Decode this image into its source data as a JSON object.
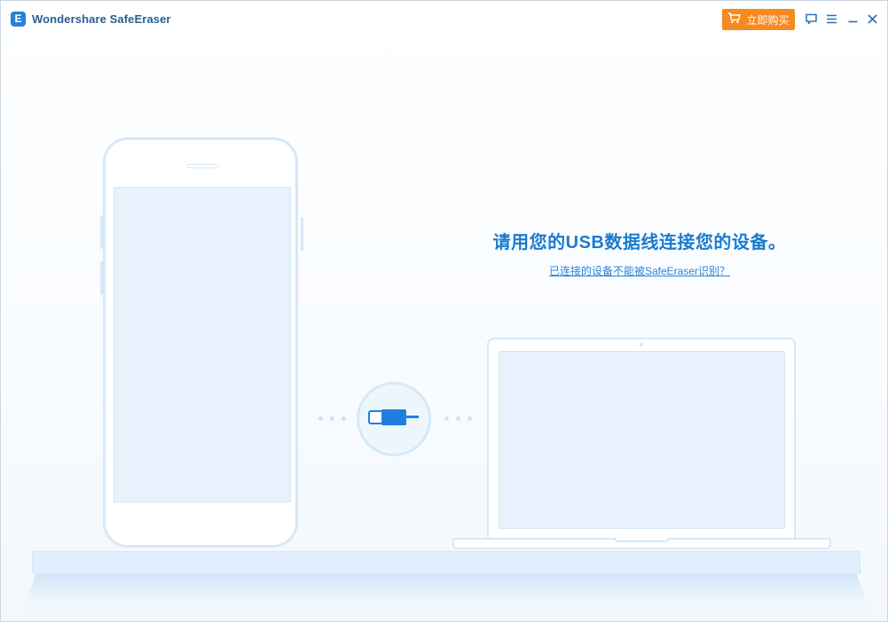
{
  "window": {
    "app_logo_letter": "E",
    "app_title": "Wondershare SafeEraser",
    "buy_button_label": "立即购买",
    "controls": [
      "feedback-icon",
      "menu-icon",
      "minimize-icon",
      "close-icon"
    ]
  },
  "main": {
    "prompt": "请用您的USB数据线连接您的设备。",
    "help_link": "已连接的设备不能被SafeEraser识别？"
  },
  "colors": {
    "accent": "#1a7bd0",
    "buy_button": "#f68a1e",
    "outline": "#d6e8f8",
    "screen_fill": "#e8f2fc",
    "usb_blue": "#1f7fe0"
  }
}
